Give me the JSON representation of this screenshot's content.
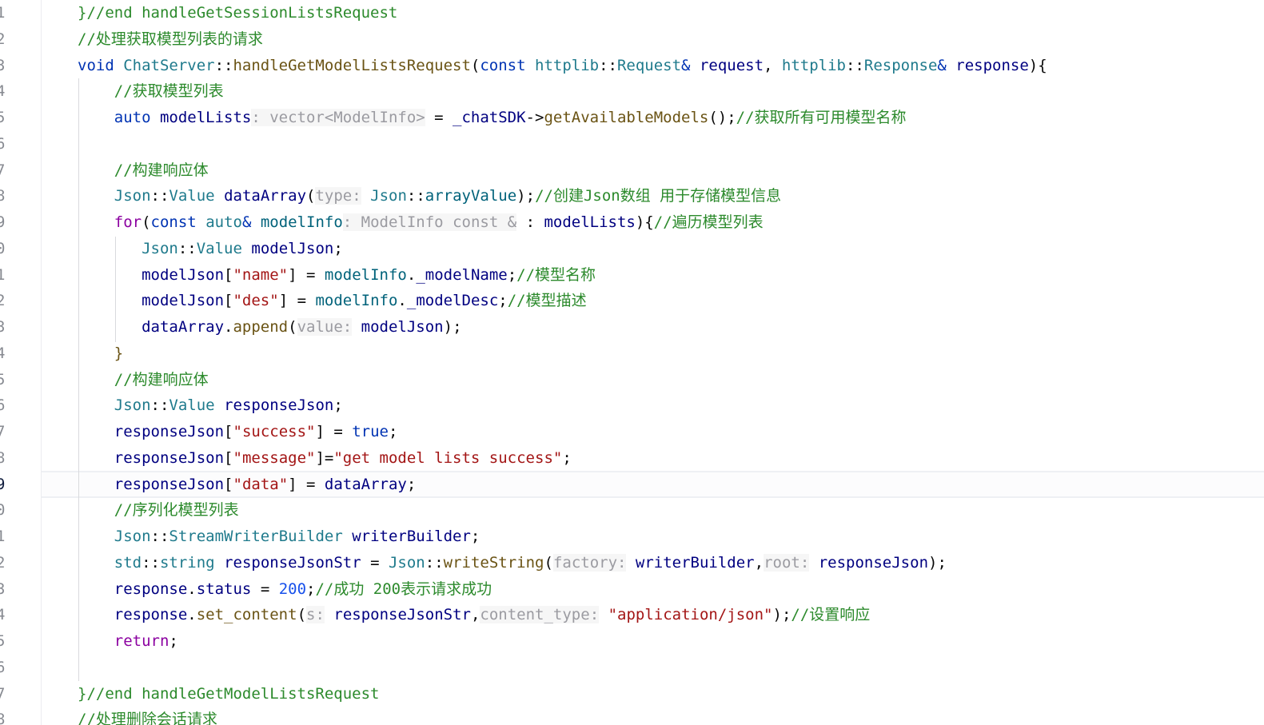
{
  "colors": {
    "background": "#ffffff",
    "keyword": "#0033b3",
    "type": "#1f7a8c",
    "function": "#00627a",
    "method": "#6a5314",
    "variable": "#000080",
    "string": "#a31515",
    "number": "#1750eb",
    "comment": "#2c8a2c",
    "inlay_hint": "#9b9ba1",
    "line_number": "#878a91"
  },
  "editor": {
    "line_numbers": [
      "1",
      "2",
      "3",
      "4",
      "5",
      "6",
      "7",
      "8",
      "9",
      "0",
      "1",
      "2",
      "3",
      "4",
      "5",
      "6",
      "7",
      "8",
      "9",
      "0",
      "1",
      "2",
      "3",
      "4",
      "5",
      "6",
      "7",
      "8"
    ],
    "active_line_index": 18,
    "lines": [
      {
        "tokens": [
          [
            "t-cmt",
            "}//end handleGetSessionListsRequest"
          ]
        ]
      },
      {
        "tokens": [
          [
            "t-cmt",
            "//处理获取模型列表的请求"
          ]
        ]
      },
      {
        "tokens": [
          [
            "t-kw",
            "void "
          ],
          [
            "t-type",
            "ChatServer"
          ],
          [
            "t-punc",
            "::"
          ],
          [
            "t-mfn",
            "handleGetModelListsRequest"
          ],
          [
            "t-punc",
            "("
          ],
          [
            "t-kw",
            "const "
          ],
          [
            "t-type",
            "httplib"
          ],
          [
            "t-punc",
            "::"
          ],
          [
            "t-type",
            "Request"
          ],
          [
            "t-kw",
            "& "
          ],
          [
            "t-var",
            "request"
          ],
          [
            "t-punc",
            ", "
          ],
          [
            "t-type",
            "httplib"
          ],
          [
            "t-punc",
            "::"
          ],
          [
            "t-type",
            "Response"
          ],
          [
            "t-kw",
            "& "
          ],
          [
            "t-var",
            "response"
          ],
          [
            "t-punc",
            "){"
          ]
        ]
      },
      {
        "tokens": [
          [
            "t-plain",
            "    "
          ],
          [
            "t-cmt",
            "//获取模型列表"
          ]
        ]
      },
      {
        "tokens": [
          [
            "t-plain",
            "    "
          ],
          [
            "t-kw",
            "auto "
          ],
          [
            "t-var",
            "modelLists"
          ],
          [
            "t-hint",
            ": vector<ModelInfo>"
          ],
          [
            "t-plain",
            " = "
          ],
          [
            "t-var",
            "_chatSDK"
          ],
          [
            "t-plain",
            "->"
          ],
          [
            "t-mfn",
            "getAvailableModels"
          ],
          [
            "t-plain",
            "();"
          ],
          [
            "t-cmt",
            "//获取所有可用模型名称"
          ]
        ]
      },
      {
        "tokens": []
      },
      {
        "tokens": [
          [
            "t-plain",
            "    "
          ],
          [
            "t-cmt",
            "//构建响应体"
          ]
        ]
      },
      {
        "tokens": [
          [
            "t-plain",
            "    "
          ],
          [
            "t-type",
            "Json"
          ],
          [
            "t-punc",
            "::"
          ],
          [
            "t-type",
            "Value "
          ],
          [
            "t-var",
            "dataArray"
          ],
          [
            "t-punc",
            "("
          ],
          [
            "t-hint",
            "type:"
          ],
          [
            "t-plain",
            " "
          ],
          [
            "t-type",
            "Json"
          ],
          [
            "t-punc",
            "::"
          ],
          [
            "t-fn",
            "arrayValue"
          ],
          [
            "t-punc",
            ");"
          ],
          [
            "t-cmt",
            "//创建Json数组 用于存储模型信息"
          ]
        ]
      },
      {
        "tokens": [
          [
            "t-plain",
            "    "
          ],
          [
            "t-flow",
            "for"
          ],
          [
            "t-punc",
            "("
          ],
          [
            "t-kw",
            "const "
          ],
          [
            "t-type",
            "auto"
          ],
          [
            "t-kw",
            "& "
          ],
          [
            "t-fn",
            "modelInfo"
          ],
          [
            "t-hint",
            ": ModelInfo const &"
          ],
          [
            "t-plain",
            " : "
          ],
          [
            "t-var",
            "modelLists"
          ],
          [
            "t-punc",
            "){"
          ],
          [
            "t-cmt",
            "//遍历模型列表"
          ]
        ]
      },
      {
        "tokens": [
          [
            "t-plain",
            "       "
          ],
          [
            "t-type",
            "Json"
          ],
          [
            "t-punc",
            "::"
          ],
          [
            "t-type",
            "Value "
          ],
          [
            "t-var",
            "modelJson"
          ],
          [
            "t-punc",
            ";"
          ]
        ]
      },
      {
        "tokens": [
          [
            "t-plain",
            "       "
          ],
          [
            "t-var",
            "modelJson"
          ],
          [
            "t-punc",
            "["
          ],
          [
            "t-str",
            "\"name\""
          ],
          [
            "t-punc",
            "]"
          ],
          [
            "t-plain",
            " = "
          ],
          [
            "t-fn",
            "modelInfo"
          ],
          [
            "t-punc",
            "."
          ],
          [
            "t-var",
            "_modelName"
          ],
          [
            "t-punc",
            ";"
          ],
          [
            "t-cmt",
            "//模型名称"
          ]
        ]
      },
      {
        "tokens": [
          [
            "t-plain",
            "       "
          ],
          [
            "t-var",
            "modelJson"
          ],
          [
            "t-punc",
            "["
          ],
          [
            "t-str",
            "\"des\""
          ],
          [
            "t-punc",
            "]"
          ],
          [
            "t-plain",
            " = "
          ],
          [
            "t-fn",
            "modelInfo"
          ],
          [
            "t-punc",
            "."
          ],
          [
            "t-var",
            "_modelDesc"
          ],
          [
            "t-punc",
            ";"
          ],
          [
            "t-cmt",
            "//模型描述"
          ]
        ]
      },
      {
        "tokens": [
          [
            "t-plain",
            "       "
          ],
          [
            "t-var",
            "dataArray"
          ],
          [
            "t-punc",
            "."
          ],
          [
            "t-mfn",
            "append"
          ],
          [
            "t-punc",
            "("
          ],
          [
            "t-hint",
            "value:"
          ],
          [
            "t-plain",
            " "
          ],
          [
            "t-var",
            "modelJson"
          ],
          [
            "t-punc",
            ");"
          ]
        ]
      },
      {
        "tokens": [
          [
            "t-plain",
            "    "
          ],
          [
            "t-mfn",
            "}"
          ]
        ]
      },
      {
        "tokens": [
          [
            "t-plain",
            "    "
          ],
          [
            "t-cmt",
            "//构建响应体"
          ]
        ]
      },
      {
        "tokens": [
          [
            "t-plain",
            "    "
          ],
          [
            "t-type",
            "Json"
          ],
          [
            "t-punc",
            "::"
          ],
          [
            "t-type",
            "Value "
          ],
          [
            "t-var",
            "responseJson"
          ],
          [
            "t-punc",
            ";"
          ]
        ]
      },
      {
        "tokens": [
          [
            "t-plain",
            "    "
          ],
          [
            "t-var",
            "responseJson"
          ],
          [
            "t-punc",
            "["
          ],
          [
            "t-str",
            "\"success\""
          ],
          [
            "t-punc",
            "]"
          ],
          [
            "t-plain",
            " = "
          ],
          [
            "t-kw",
            "true"
          ],
          [
            "t-punc",
            ";"
          ]
        ]
      },
      {
        "tokens": [
          [
            "t-plain",
            "    "
          ],
          [
            "t-var",
            "responseJson"
          ],
          [
            "t-punc",
            "["
          ],
          [
            "t-str",
            "\"message\""
          ],
          [
            "t-punc",
            "]="
          ],
          [
            "t-str",
            "\"get model lists success\""
          ],
          [
            "t-punc",
            ";"
          ]
        ]
      },
      {
        "tokens": [
          [
            "t-plain",
            "    "
          ],
          [
            "t-var",
            "responseJson"
          ],
          [
            "t-punc",
            "["
          ],
          [
            "t-str",
            "\"data\""
          ],
          [
            "t-punc",
            "]"
          ],
          [
            "t-plain",
            " = "
          ],
          [
            "t-var",
            "dataArray"
          ],
          [
            "t-punc",
            ";"
          ]
        ]
      },
      {
        "tokens": [
          [
            "t-plain",
            "    "
          ],
          [
            "t-cmt",
            "//序列化模型列表"
          ]
        ]
      },
      {
        "tokens": [
          [
            "t-plain",
            "    "
          ],
          [
            "t-type",
            "Json"
          ],
          [
            "t-punc",
            "::"
          ],
          [
            "t-type",
            "StreamWriterBuilder "
          ],
          [
            "t-var",
            "writerBuilder"
          ],
          [
            "t-punc",
            ";"
          ]
        ]
      },
      {
        "tokens": [
          [
            "t-plain",
            "    "
          ],
          [
            "t-type",
            "std"
          ],
          [
            "t-punc",
            "::"
          ],
          [
            "t-type",
            "string "
          ],
          [
            "t-var",
            "responseJsonStr"
          ],
          [
            "t-plain",
            " = "
          ],
          [
            "t-type",
            "Json"
          ],
          [
            "t-punc",
            "::"
          ],
          [
            "t-mfn",
            "writeString"
          ],
          [
            "t-punc",
            "("
          ],
          [
            "t-hint",
            "factory:"
          ],
          [
            "t-plain",
            " "
          ],
          [
            "t-var",
            "writerBuilder"
          ],
          [
            "t-punc",
            ","
          ],
          [
            "t-hint",
            "root:"
          ],
          [
            "t-plain",
            " "
          ],
          [
            "t-var",
            "responseJson"
          ],
          [
            "t-punc",
            ");"
          ]
        ]
      },
      {
        "tokens": [
          [
            "t-plain",
            "    "
          ],
          [
            "t-var",
            "response"
          ],
          [
            "t-punc",
            "."
          ],
          [
            "t-var",
            "status"
          ],
          [
            "t-plain",
            " = "
          ],
          [
            "t-num",
            "200"
          ],
          [
            "t-punc",
            ";"
          ],
          [
            "t-cmt",
            "//成功 200表示请求成功"
          ]
        ]
      },
      {
        "tokens": [
          [
            "t-plain",
            "    "
          ],
          [
            "t-var",
            "response"
          ],
          [
            "t-punc",
            "."
          ],
          [
            "t-mfn",
            "set_content"
          ],
          [
            "t-punc",
            "("
          ],
          [
            "t-hint",
            "s:"
          ],
          [
            "t-plain",
            " "
          ],
          [
            "t-var",
            "responseJsonStr"
          ],
          [
            "t-punc",
            ","
          ],
          [
            "t-hint",
            "content_type:"
          ],
          [
            "t-plain",
            " "
          ],
          [
            "t-str",
            "\"application/json\""
          ],
          [
            "t-punc",
            ");"
          ],
          [
            "t-cmt",
            "//设置响应"
          ]
        ]
      },
      {
        "tokens": [
          [
            "t-plain",
            "    "
          ],
          [
            "t-flow",
            "return"
          ],
          [
            "t-punc",
            ";"
          ]
        ]
      },
      {
        "tokens": []
      },
      {
        "tokens": [
          [
            "t-cmt",
            "}//end handleGetModelListsRequest"
          ]
        ]
      },
      {
        "tokens": [
          [
            "t-cmt",
            "//处理删除会话请求"
          ]
        ]
      }
    ]
  }
}
